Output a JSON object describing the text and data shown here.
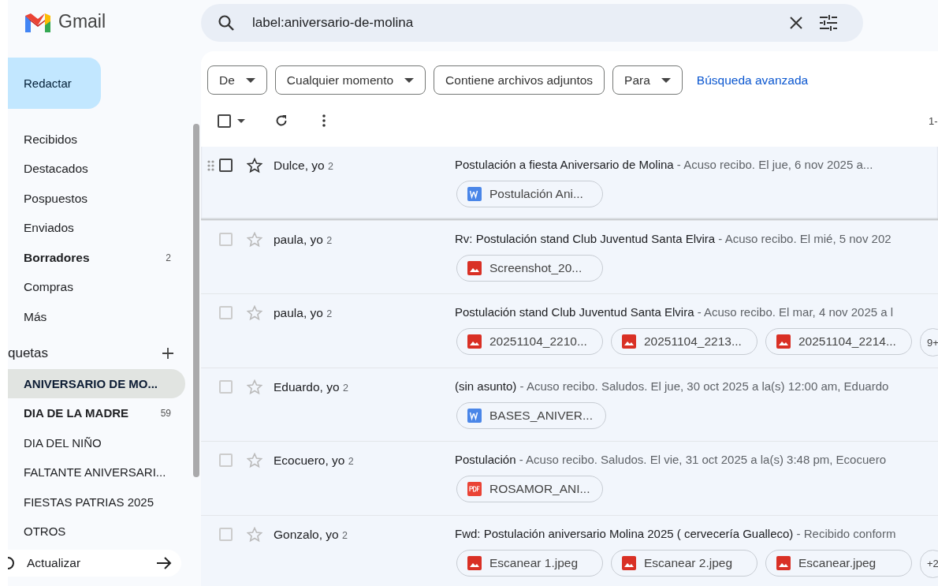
{
  "app": {
    "name": "Gmail"
  },
  "search": {
    "value": "label:aniversario-de-molina"
  },
  "compose": {
    "label": "Redactar"
  },
  "nav": [
    {
      "label": "Recibidos",
      "unread": false
    },
    {
      "label": "Destacados",
      "unread": false
    },
    {
      "label": "Pospuestos",
      "unread": false
    },
    {
      "label": "Enviados",
      "unread": false
    },
    {
      "label": "Borradores",
      "unread": true,
      "count": "2"
    },
    {
      "label": "Compras",
      "unread": false
    },
    {
      "label": "Más",
      "unread": false
    }
  ],
  "labels_header": "quetas",
  "labels": [
    {
      "label": "ANIVERSARIO DE MO...",
      "selected": true,
      "unread": true
    },
    {
      "label": "DIA DE LA MADRE",
      "selected": false,
      "unread": true,
      "count": "59"
    },
    {
      "label": "DIA DEL NIÑO",
      "selected": false,
      "unread": false
    },
    {
      "label": "FALTANTE ANIVERSARI...",
      "selected": false,
      "unread": false
    },
    {
      "label": "FIESTAS PATRIAS 2025",
      "selected": false,
      "unread": false
    },
    {
      "label": "OTROS",
      "selected": false,
      "unread": false
    }
  ],
  "update_bar": {
    "label": "Actualizar"
  },
  "filters": [
    {
      "label": "De",
      "dropdown": true
    },
    {
      "label": "Cualquier momento",
      "dropdown": true
    },
    {
      "label": "Contiene archivos adjuntos",
      "dropdown": false
    },
    {
      "label": "Para",
      "dropdown": true
    }
  ],
  "advanced_search": "Búsqueda avanzada",
  "pagination": "1-",
  "select_all": {
    "checked": false
  },
  "rows": [
    {
      "sender": "Dulce, yo",
      "count": "2",
      "subject": "Postulación a fiesta Aniversario de Molina",
      "snippet": "- Acuso recibo. El jue, 6 nov 2025 a...",
      "hovered": true,
      "attachments": [
        {
          "kind": "word",
          "name": "Postulación Ani..."
        }
      ]
    },
    {
      "sender": "paula, yo",
      "count": "2",
      "subject": "Rv: Postulación stand Club Juventud Santa Elvira",
      "snippet": "- Acuso recibo. El mié, 5 nov 202",
      "hovered": false,
      "attachments": [
        {
          "kind": "image",
          "name": "Screenshot_20..."
        }
      ]
    },
    {
      "sender": "paula, yo",
      "count": "2",
      "subject": "Postulación stand Club Juventud Santa Elvira",
      "snippet": "- Acuso recibo. El mar, 4 nov 2025 a l",
      "hovered": false,
      "attachments": [
        {
          "kind": "image",
          "name": "20251104_2210..."
        },
        {
          "kind": "image",
          "name": "20251104_2213..."
        },
        {
          "kind": "image",
          "name": "20251104_2214..."
        }
      ],
      "more": "9+"
    },
    {
      "sender": "Eduardo, yo",
      "count": "2",
      "subject": "(sin asunto)",
      "snippet": "- Acuso recibo. Saludos. El jue, 30 oct 2025 a la(s) 12:00 am, Eduardo",
      "hovered": false,
      "attachments": [
        {
          "kind": "word",
          "name": "BASES_ANIVER..."
        }
      ]
    },
    {
      "sender": "Ecocuero, yo",
      "count": "2",
      "subject": "Postulación",
      "snippet": "- Acuso recibo. Saludos. El vie, 31 oct 2025 a la(s) 3:48 pm, Ecocuero",
      "hovered": false,
      "attachments": [
        {
          "kind": "pdf",
          "name": "ROSAMOR_ANI..."
        }
      ]
    },
    {
      "sender": "Gonzalo, yo",
      "count": "2",
      "subject": "Fwd: Postulación aniversario Molina 2025 ( cervecería Gualleco)",
      "snippet": "- Recibido conform",
      "hovered": false,
      "attachments": [
        {
          "kind": "image",
          "name": "Escanear 1.jpeg"
        },
        {
          "kind": "image",
          "name": "Escanear 2.jpeg"
        },
        {
          "kind": "image",
          "name": "Escanear.jpeg"
        }
      ],
      "more": "+2"
    }
  ]
}
